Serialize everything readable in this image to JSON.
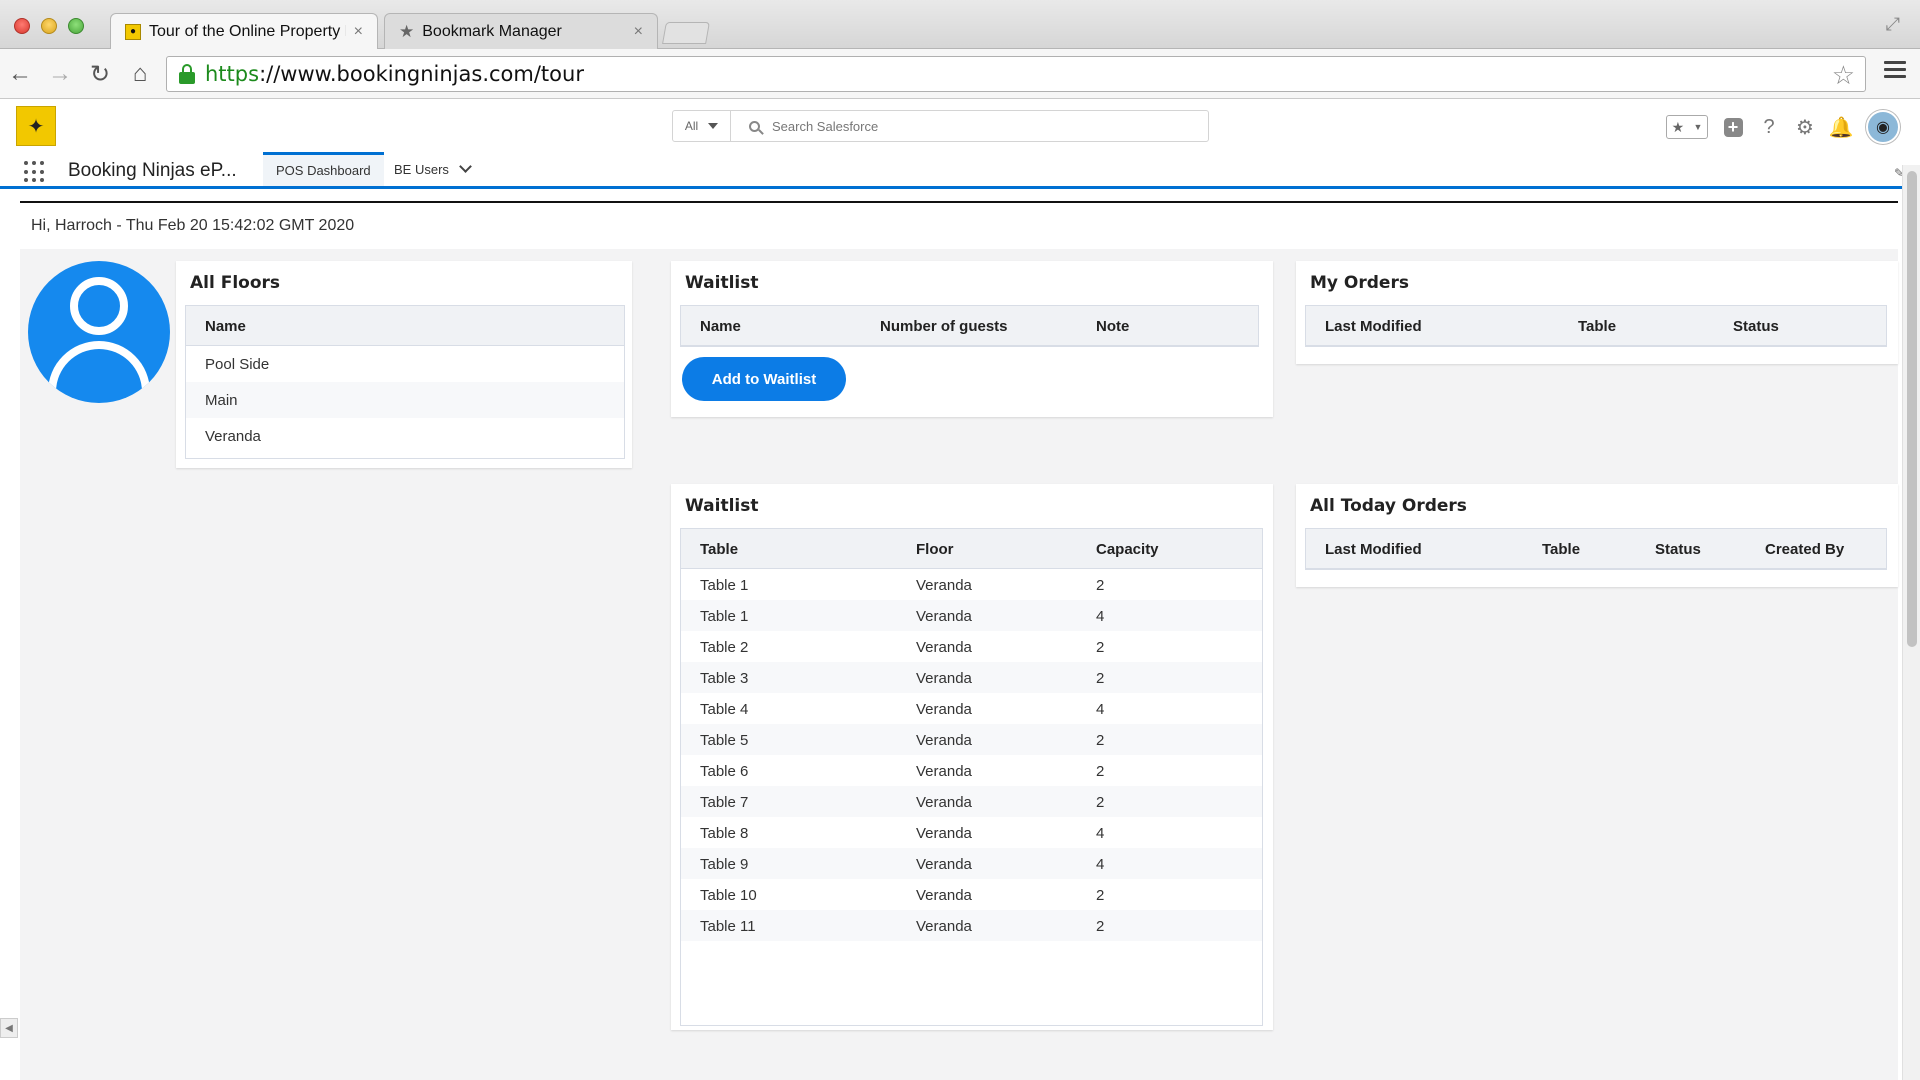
{
  "browser": {
    "tabs": [
      {
        "title": "Tour of the Online Property Ma",
        "active": true,
        "icon": "ninja-favicon"
      },
      {
        "title": "Bookmark Manager",
        "active": false,
        "icon": "star-icon"
      }
    ],
    "url_scheme": "https",
    "url_rest": "://www.bookingninjas.com/tour"
  },
  "sf_header": {
    "search_scope": "All",
    "search_placeholder": "Search Salesforce",
    "app_name": "Booking Ninjas eP...",
    "nav_tabs": [
      {
        "label": "POS Dashboard",
        "active": true
      },
      {
        "label": "BE Users",
        "active": false
      }
    ]
  },
  "greeting": "Hi, Harroch - Thu Feb 20 15:42:02 GMT 2020",
  "floors": {
    "title": "All Floors",
    "column": "Name",
    "rows": [
      "Pool Side",
      "Main",
      "Veranda"
    ]
  },
  "waitlist": {
    "title": "Waitlist",
    "columns": [
      "Name",
      "Number of guests",
      "Note"
    ],
    "add_button": "Add to Waitlist"
  },
  "my_orders": {
    "title": "My Orders",
    "columns": [
      "Last Modified",
      "Table",
      "Status"
    ]
  },
  "tables": {
    "title": "Waitlist",
    "columns": [
      "Table",
      "Floor",
      "Capacity"
    ],
    "rows": [
      [
        "Table 1",
        "Veranda",
        "2"
      ],
      [
        "Table 1",
        "Veranda",
        "4"
      ],
      [
        "Table 2",
        "Veranda",
        "2"
      ],
      [
        "Table 3",
        "Veranda",
        "2"
      ],
      [
        "Table 4",
        "Veranda",
        "4"
      ],
      [
        "Table 5",
        "Veranda",
        "2"
      ],
      [
        "Table 6",
        "Veranda",
        "2"
      ],
      [
        "Table 7",
        "Veranda",
        "2"
      ],
      [
        "Table 8",
        "Veranda",
        "4"
      ],
      [
        "Table 9",
        "Veranda",
        "4"
      ],
      [
        "Table 10",
        "Veranda",
        "2"
      ],
      [
        "Table 11",
        "Veranda",
        "2"
      ]
    ]
  },
  "today_orders": {
    "title": "All Today Orders",
    "columns": [
      "Last Modified",
      "Table",
      "Status",
      "Created By"
    ]
  },
  "colors": {
    "brand_blue": "#0070d2",
    "button_blue": "#0c7ce6",
    "avatar_blue": "#1589ee",
    "secure_green": "#1c8a1c"
  }
}
